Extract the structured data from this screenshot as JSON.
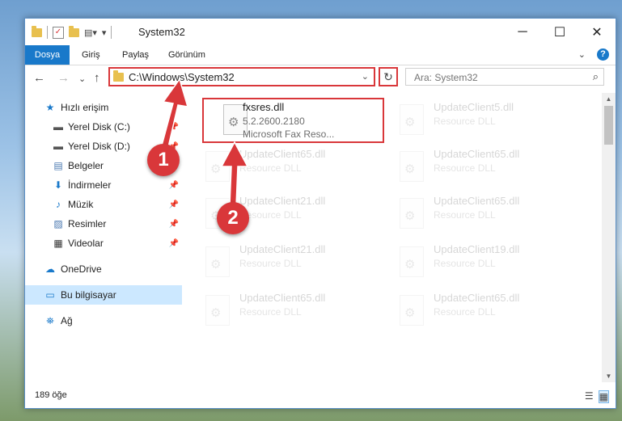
{
  "window": {
    "title": "System32",
    "controls": {
      "minimize": "─",
      "maximize": "☐",
      "close": "✕"
    }
  },
  "ribbon": {
    "tabs": [
      "Dosya",
      "Giriş",
      "Paylaş",
      "Görünüm"
    ],
    "help": "?"
  },
  "navigation": {
    "back": "←",
    "forward": "→",
    "recent": "⌄",
    "up": "↑",
    "address": "C:\\Windows\\System32",
    "refresh": "↻",
    "search_placeholder": "Ara: System32"
  },
  "sidebar": {
    "items": [
      {
        "label": "Hızlı erişim",
        "icon": "★",
        "icon_name": "star-icon"
      },
      {
        "label": "Yerel Disk (C:)",
        "icon": "▬",
        "icon_name": "drive-icon",
        "pinned": true
      },
      {
        "label": "Yerel Disk (D:)",
        "icon": "▬",
        "icon_name": "drive-icon",
        "pinned": true
      },
      {
        "label": "Belgeler",
        "icon": "▤",
        "icon_name": "document-icon",
        "pinned": true
      },
      {
        "label": "İndirmeler",
        "icon": "⬇",
        "icon_name": "download-icon",
        "pinned": true
      },
      {
        "label": "Müzik",
        "icon": "♪",
        "icon_name": "music-icon",
        "pinned": true
      },
      {
        "label": "Resimler",
        "icon": "▨",
        "icon_name": "pictures-icon",
        "pinned": true
      },
      {
        "label": "Videolar",
        "icon": "▦",
        "icon_name": "video-icon",
        "pinned": true
      },
      {
        "label": "OneDrive",
        "icon": "☁",
        "icon_name": "cloud-icon"
      },
      {
        "label": "Bu bilgisayar",
        "icon": "▭",
        "icon_name": "computer-icon",
        "selected": true
      },
      {
        "label": "Ağ",
        "icon": "⛯",
        "icon_name": "network-icon"
      }
    ]
  },
  "files": [
    {
      "name": "fxsres.dll",
      "version": "5.2.2600.2180",
      "desc": "Microsoft  Fax Reso...",
      "selected": true
    },
    {
      "name": "UpdateClient5.dll",
      "desc": "Resource DLL"
    },
    {
      "name": "UpdateClient65.dll",
      "desc": "Resource DLL"
    },
    {
      "name": "UpdateClient65.dll",
      "desc": "Resource DLL"
    },
    {
      "name": "UpdateClient21.dll",
      "desc": "Resource DLL"
    },
    {
      "name": "UpdateClient65.dll",
      "desc": "Resource DLL"
    },
    {
      "name": "UpdateClient21.dll",
      "desc": "Resource DLL"
    },
    {
      "name": "UpdateClient19.dll",
      "desc": "Resource DLL"
    },
    {
      "name": "UpdateClient65.dll",
      "desc": "Resource DLL"
    },
    {
      "name": "UpdateClient65.dll",
      "desc": "Resource DLL"
    }
  ],
  "status": {
    "count": "189 öğe"
  },
  "callouts": [
    "1",
    "2"
  ],
  "colors": {
    "accent": "#1979ca",
    "highlight": "#d9373a",
    "selection": "#cce8ff"
  }
}
